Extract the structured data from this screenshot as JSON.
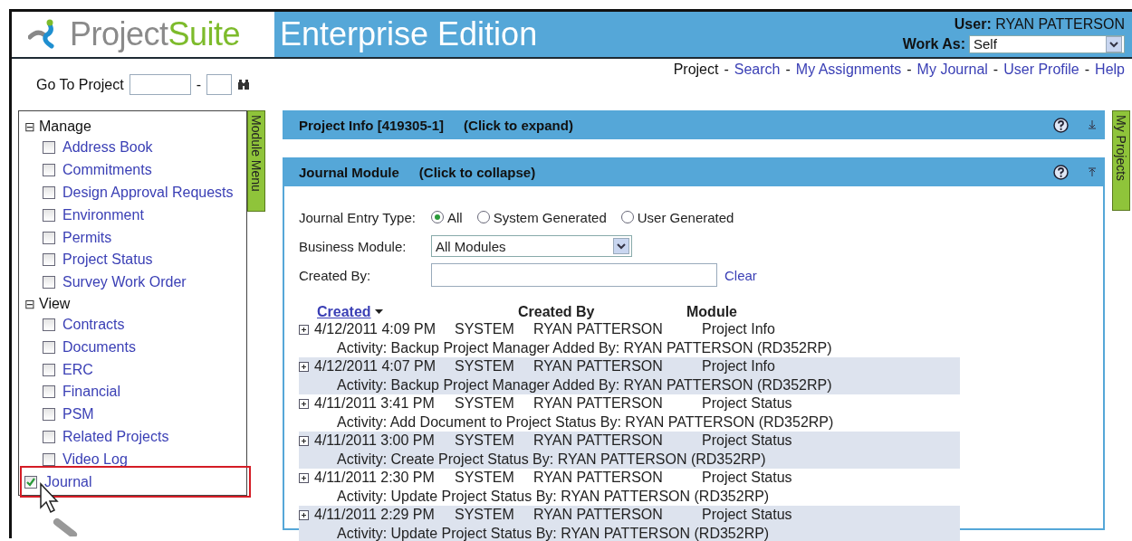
{
  "header": {
    "brand_part1": "Project",
    "brand_part2": "Suite",
    "edition": "Enterprise Edition",
    "user_label": "User:",
    "user_name": "RYAN PATTERSON",
    "work_as_label": "Work As:",
    "work_as_value": "Self"
  },
  "goto": {
    "label": "Go To Project",
    "separator": "-"
  },
  "nav": [
    {
      "label": "Project",
      "kind": "current"
    },
    {
      "label": "Search",
      "kind": "link"
    },
    {
      "label": "My Assignments",
      "kind": "link"
    },
    {
      "label": "My Journal",
      "kind": "link"
    },
    {
      "label": "User Profile",
      "kind": "link"
    },
    {
      "label": "Help",
      "kind": "link"
    }
  ],
  "nav_separator": "-",
  "sidebar": {
    "tab": "Module Menu",
    "groups": [
      {
        "label": "Manage",
        "expander": "⊟",
        "items": [
          {
            "label": "Address Book",
            "checked": false,
            "highlighted": false
          },
          {
            "label": "Commitments",
            "checked": false,
            "highlighted": false
          },
          {
            "label": "Design Approval Requests",
            "checked": false,
            "highlighted": false
          },
          {
            "label": "Environment",
            "checked": false,
            "highlighted": false
          },
          {
            "label": "Permits",
            "checked": false,
            "highlighted": false
          },
          {
            "label": "Project Status",
            "checked": false,
            "highlighted": false
          },
          {
            "label": "Survey Work Order",
            "checked": false,
            "highlighted": false
          }
        ]
      },
      {
        "label": "View",
        "expander": "⊟",
        "items": [
          {
            "label": "Contracts",
            "checked": false,
            "highlighted": false
          },
          {
            "label": "Documents",
            "checked": false,
            "highlighted": false
          },
          {
            "label": "ERC",
            "checked": false,
            "highlighted": false
          },
          {
            "label": "Financial",
            "checked": false,
            "highlighted": false
          },
          {
            "label": "PSM",
            "checked": false,
            "highlighted": false
          },
          {
            "label": "Related Projects",
            "checked": false,
            "highlighted": false
          },
          {
            "label": "Video Log",
            "checked": false,
            "highlighted": false
          }
        ]
      }
    ],
    "extra_items": [
      {
        "label": "Journal",
        "checked": true,
        "highlighted": true
      }
    ]
  },
  "right_tab": "My Projects",
  "panels": [
    {
      "title": "Project Info [419305-1]",
      "hint": "(Click to expand)",
      "expanded": false
    },
    {
      "title": "Journal Module",
      "hint": "(Click to collapse)",
      "expanded": true
    }
  ],
  "journal": {
    "entry_type_label": "Journal Entry Type:",
    "entry_types": [
      {
        "label": "All",
        "selected": true
      },
      {
        "label": "System Generated",
        "selected": false
      },
      {
        "label": "User Generated",
        "selected": false
      }
    ],
    "business_module_label": "Business Module:",
    "business_module_value": "All Modules",
    "created_by_label": "Created By:",
    "clear": "Clear",
    "columns": [
      {
        "label": "Created",
        "kind": "sort"
      },
      {
        "label": "Created By",
        "kind": "plain"
      },
      {
        "label": "Module",
        "kind": "plain"
      }
    ],
    "rows": [
      {
        "created": "4/12/2011 4:09 PM",
        "source": "SYSTEM",
        "created_by": "RYAN PATTERSON",
        "module": "Project Info",
        "activity": "Activity: Backup Project Manager Added By: RYAN PATTERSON (RD352RP)"
      },
      {
        "created": "4/12/2011 4:07 PM",
        "source": "SYSTEM",
        "created_by": "RYAN PATTERSON",
        "module": "Project Info",
        "activity": "Activity: Backup Project Manager Added By: RYAN PATTERSON (RD352RP)"
      },
      {
        "created": "4/11/2011 3:41 PM",
        "source": "SYSTEM",
        "created_by": "RYAN PATTERSON",
        "module": "Project Status",
        "activity": "Activity: Add Document to Project Status By: RYAN PATTERSON (RD352RP)"
      },
      {
        "created": "4/11/2011 3:00 PM",
        "source": "SYSTEM",
        "created_by": "RYAN PATTERSON",
        "module": "Project Status",
        "activity": "Activity: Create Project Status By: RYAN PATTERSON (RD352RP)"
      },
      {
        "created": "4/11/2011 2:30 PM",
        "source": "SYSTEM",
        "created_by": "RYAN PATTERSON",
        "module": "Project Status",
        "activity": "Activity: Update Project Status By: RYAN PATTERSON (RD352RP)"
      },
      {
        "created": "4/11/2011 2:29 PM",
        "source": "SYSTEM",
        "created_by": "RYAN PATTERSON",
        "module": "Project Status",
        "activity": "Activity: Update Project Status By: RYAN PATTERSON (RD352RP)"
      }
    ]
  }
}
